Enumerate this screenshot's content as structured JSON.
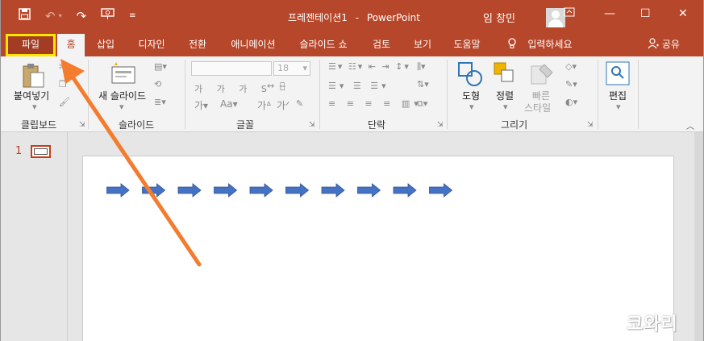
{
  "titlebar": {
    "doc_name": "프레젠테이션1",
    "separator": "-",
    "app_name": "PowerPoint",
    "user_name": "임 창민",
    "qat_icons": [
      "save-icon",
      "undo-icon",
      "redo-icon",
      "present-icon",
      "customize-icon"
    ],
    "window_controls": [
      "ribbon-display-icon",
      "minimize-icon",
      "maximize-icon",
      "close-icon"
    ]
  },
  "tabs": {
    "items": [
      "파일",
      "홈",
      "삽입",
      "디자인",
      "전환",
      "애니메이션",
      "슬라이드 쇼",
      "검토",
      "보기",
      "도움말"
    ],
    "tell_me": "입력하세요",
    "share": "공유"
  },
  "ribbon": {
    "clipboard": {
      "label": "클립보드",
      "paste": "붙여넣기"
    },
    "slides": {
      "label": "슬라이드",
      "new_slide": "새 슬라이드"
    },
    "font": {
      "label": "글꼴",
      "font_size": "18"
    },
    "paragraph": {
      "label": "단락"
    },
    "drawing": {
      "label": "그리기",
      "shapes": "도형",
      "arrange": "정렬",
      "quick_styles_1": "빠른",
      "quick_styles_2": "스타일"
    },
    "editing": {
      "label": "편집"
    }
  },
  "slide_pane": {
    "slide_number": "1"
  },
  "slide": {
    "arrow_count": 10
  },
  "watermark": "코와리",
  "colors": {
    "accent": "#b7472a",
    "highlight": "#ffe500",
    "arrow_annotation": "#f47c2f",
    "shape_fill": "#4472c4"
  }
}
